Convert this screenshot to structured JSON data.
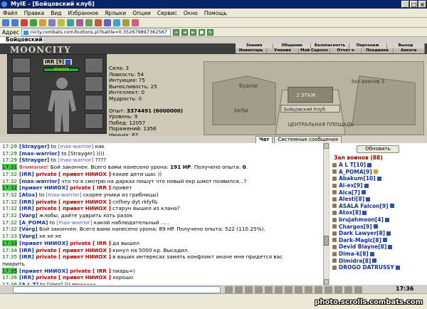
{
  "window": {
    "title": "MyIE - [Бойцовский клуб]"
  },
  "menu": [
    "Файл",
    "Правка",
    "Вид",
    "Избранное",
    "Ярлыки",
    "Опции",
    "Сервис",
    "Окно",
    "Помощь"
  ],
  "address": {
    "label": "Адрес",
    "url": "nicty.combats.com/buttons.pl?battle=0.352679897362567"
  },
  "tab": {
    "title": "Бойцовский"
  },
  "game": {
    "logo": "MOONCITY",
    "nav_top": [
      "Знания",
      "Общение",
      "Безопасность",
      "Персонаж",
      "Выход"
    ],
    "nav_bottom": [
      "Инвентарь",
      "Умения",
      "Мой Скролл",
      "Отчет о переводах",
      "Поединки",
      "Анкета"
    ]
  },
  "character": {
    "name": "IRR [9]",
    "hp": "374/374",
    "stats": [
      {
        "label": "Сила:",
        "value": "3"
      },
      {
        "label": "Ловкость:",
        "value": "54"
      },
      {
        "label": "Интуиция:",
        "value": "75"
      },
      {
        "label": "Выносливость:",
        "value": "25"
      },
      {
        "label": "Интеллект:",
        "value": "0"
      },
      {
        "label": "Мудрость:",
        "value": "0"
      }
    ],
    "stats2": [
      {
        "label": "Опыт:",
        "value": "3374491 (6000000)"
      },
      {
        "label": "Уровень:",
        "value": "9"
      },
      {
        "label": "Побед:",
        "value": "12057"
      },
      {
        "label": "Поражений:",
        "value": "1356"
      },
      {
        "label": "Ничьих:",
        "value": "67"
      }
    ]
  },
  "map": {
    "labels": {
      "budar": "Будуар",
      "hall3": "Зал воинов 3",
      "floor2": "2 ЭТАЖ",
      "club": "Бойцовский Клуб",
      "halls": "ЗАЛЫ",
      "central": "ЦЕНТРАЛЬНАЯ ПЛОЩАДЬ"
    }
  },
  "chat_tabs": [
    "Чат",
    "Системные сообщения"
  ],
  "chat": [
    {
      "t": "17:29",
      "parts": [
        [
          "nick",
          "[Strayger]"
        ],
        [
          "",
          " to "
        ],
        [
          "tgt",
          "[max-warrior]"
        ],
        [
          "",
          " как "
        ]
      ]
    },
    {
      "t": "17:29",
      "parts": [
        [
          "nick",
          "[max-warrior]"
        ],
        [
          "",
          " to [Strayger] ))))"
        ]
      ]
    },
    {
      "t": "17:29",
      "parts": [
        [
          "nick",
          "[Strayger]"
        ],
        [
          "",
          " to "
        ],
        [
          "tgt",
          "[max-warrior]"
        ],
        [
          "",
          " ????"
        ]
      ]
    },
    {
      "t": "17:31",
      "hl": true,
      "parts": [
        [
          "sys",
          "Внимание!"
        ],
        [
          "",
          " Бой закончен. Всего вами нанесено урона: "
        ],
        [
          "bold",
          "191 HP"
        ],
        [
          "",
          ". Получено опыта: "
        ],
        [
          "bold",
          "0"
        ],
        [
          "",
          "."
        ]
      ]
    },
    {
      "t": "",
      "parts": [
        [
          "",
          " "
        ]
      ]
    },
    {
      "t": "17:32",
      "parts": [
        [
          "nick",
          "[IRR]"
        ],
        [
          "priv",
          " private [ привет НИИОХ ]"
        ],
        [
          "",
          " какие дети щас ))"
        ]
      ]
    },
    {
      "t": "17:32",
      "parts": [
        [
          "nick",
          "[max-warrior]"
        ],
        [
          "",
          " что то я смотрю на дарках пишут что новый екр шмот появился...?"
        ]
      ]
    },
    {
      "t": "17:32",
      "hl": true,
      "parts": [
        [
          "nick",
          "[привет НИИОХ]"
        ],
        [
          "priv",
          " private [ IRR ]"
        ],
        [
          "",
          " привет"
        ]
      ]
    },
    {
      "t": "17:32",
      "parts": [
        [
          "nick",
          "[Atox]"
        ],
        [
          "",
          " to "
        ],
        [
          "tgt",
          "[max-warrior]"
        ],
        [
          "",
          " скорее уники из грибницы)"
        ]
      ]
    },
    {
      "t": "17:32",
      "parts": [
        [
          "nick",
          "[IRR]"
        ],
        [
          "priv",
          " private [ привет НИИОХ ]"
        ],
        [
          "",
          " cnfhey dyt rkfyf&"
        ]
      ]
    },
    {
      "t": "17:32",
      "parts": [
        [
          "nick",
          "[IRR]"
        ],
        [
          "priv",
          " private [ привет НИИОХ ]"
        ],
        [
          "",
          " старун вышел из клана?"
        ]
      ]
    },
    {
      "t": "17:32",
      "parts": [
        [
          "nick",
          "[Varg]"
        ],
        [
          "",
          " жлобы, дайте удврить хоть разок"
        ]
      ]
    },
    {
      "t": "17:32",
      "parts": [
        [
          "nick",
          "[A_POMA]"
        ],
        [
          "",
          " to "
        ],
        [
          "tgt",
          "[max-warrior]"
        ],
        [
          "",
          " какой наблюдательный ....."
        ]
      ]
    },
    {
      "t": "17:32",
      "parts": [
        [
          "nick",
          "[Varg]"
        ],
        [
          "",
          " Бой закончен. Всего вами нанесено урона: 89 HP. Получено опыта: 522 (110.25%)."
        ]
      ]
    },
    {
      "t": "17:33",
      "parts": [
        [
          "nick",
          "[Varg]"
        ],
        [
          "",
          "  хе хе хе"
        ]
      ]
    },
    {
      "t": "17:33",
      "hl": true,
      "parts": [
        [
          "nick",
          "[привет НИИОХ]"
        ],
        [
          "priv",
          " private [ IRR ]"
        ],
        [
          "",
          " да вышел"
        ]
      ]
    },
    {
      "t": "17:34",
      "parts": [
        [
          "nick",
          "[IRR]"
        ],
        [
          "priv",
          " private [ привет НИИОХ ]"
        ],
        [
          "",
          " кинул на 5000 кр. Высадил."
        ]
      ]
    },
    {
      "t": "17:35",
      "parts": [
        [
          "nick",
          "[IRR]"
        ],
        [
          "priv",
          " private [ привет НИИОХ ]"
        ],
        [
          "",
          " в ваших интересах замять конфликт иначе мне придется вас"
        ]
      ]
    },
    {
      "t": "",
      "parts": [
        [
          "",
          "пиарить"
        ]
      ]
    },
    {
      "t": "17:35",
      "hl": true,
      "parts": [
        [
          "nick",
          "[привет НИИОХ]"
        ],
        [
          "priv",
          " private [ IRR ]"
        ],
        [
          "",
          " пиарь=)"
        ]
      ]
    },
    {
      "t": "17:36",
      "parts": [
        [
          "nick",
          "[IRR]"
        ],
        [
          "priv",
          " private [ привет НИИОХ ]"
        ],
        [
          "",
          " хорошо"
        ]
      ]
    },
    {
      "t": "17:36",
      "parts": [
        [
          "nick",
          "[A L T]"
        ],
        [
          "",
          " to [Varg] ))) мощьььь"
        ]
      ]
    }
  ],
  "users": {
    "refresh_label": "Обновить",
    "hall_title": "Зал воинов (88)",
    "list": [
      {
        "name": "A L T",
        "lvl": "[10]",
        "c": "#3050b0"
      },
      {
        "name": "A_POMA",
        "lvl": "[9]",
        "c": "#d0a020"
      },
      {
        "name": "Abakum",
        "lvl": "[10]",
        "c": "#3050b0"
      },
      {
        "name": "Al-ex",
        "lvl": "[9]",
        "c": "#3050b0"
      },
      {
        "name": "Alca",
        "lvl": "[7]",
        "c": "#3050b0"
      },
      {
        "name": "Alesti",
        "lvl": "[8]",
        "c": "#3050b0"
      },
      {
        "name": "ASALA Falcon",
        "lvl": "[9]",
        "c": "#3050b0"
      },
      {
        "name": "Atox",
        "lvl": "[8]",
        "c": "#3050b0"
      },
      {
        "name": "brujahmoon",
        "lvl": "[4]",
        "c": "#3050b0"
      },
      {
        "name": "Chargos",
        "lvl": "[9]",
        "c": "#3050b0"
      },
      {
        "name": "Dark Lawyer",
        "lvl": "[8]",
        "c": "#3050b0"
      },
      {
        "name": "Dark-Magic",
        "lvl": "[8]",
        "c": "#3050b0"
      },
      {
        "name": "Devid Blayne",
        "lvl": "[8]",
        "c": "#3050b0"
      },
      {
        "name": "Dima-k",
        "lvl": "[8]",
        "c": "#3050b0"
      },
      {
        "name": "Dimidra",
        "lvl": "[8]",
        "c": "#3050b0"
      },
      {
        "name": "DROGO DATRUSSY",
        "lvl": "",
        "c": "#3050b0"
      }
    ]
  },
  "clock": "17:36",
  "watermark": "photo.scrolls.combats.com"
}
